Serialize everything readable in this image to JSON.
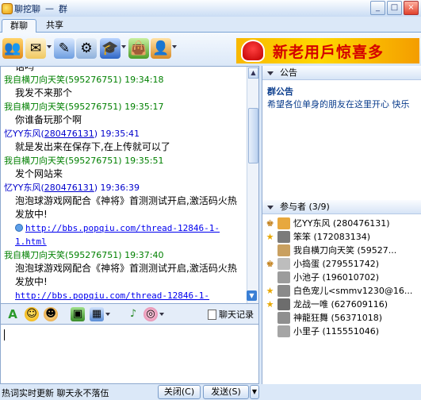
{
  "window": {
    "app_name": "聊挖聊",
    "separator": "—",
    "group_name": "群",
    "buttons": [
      "_",
      "□",
      "×"
    ]
  },
  "tabs": [
    {
      "label": "群聊",
      "active": true
    },
    {
      "label": "共享",
      "active": false
    }
  ],
  "toolbar": {
    "icons": [
      "group-members-icon",
      "mail-icon",
      "tools-icon",
      "settings-icon",
      "cap-icon",
      "bag-icon",
      "person-arrow-icon"
    ]
  },
  "ad_banner": {
    "text": "新老用戶惊喜多"
  },
  "chat": {
    "messages": [
      {
        "sender": "我自横刀向天笑",
        "qq": "595276751",
        "time": "19:34:18",
        "color": "green",
        "lines": [
          "我发不来那个"
        ]
      },
      {
        "sender": "我自横刀向天笑",
        "qq": "595276751",
        "time": "19:35:17",
        "color": "green",
        "lines": [
          "你谁备玩那个啊"
        ]
      },
      {
        "sender": "忆YY东风",
        "qq": "280476131",
        "time": "19:35:41",
        "color": "blue",
        "lines": [
          "就是发出来在保存下,在上传就可以了"
        ]
      },
      {
        "sender": "我自横刀向天笑",
        "qq": "595276751",
        "time": "19:35:51",
        "color": "green",
        "lines": [
          "发个网站来"
        ]
      },
      {
        "sender": "忆YY东风",
        "qq": "280476131",
        "time": "19:36:39",
        "color": "blue",
        "text": "泡泡球游戏网配合《神将》首测测试开启,激活码火热发放中!",
        "link": "http://bbs.popqiu.com/thread-12846-1-1.html"
      },
      {
        "sender": "我自横刀向天笑",
        "qq": "595276751",
        "time": "19:37:40",
        "color": "green",
        "text": "泡泡球游戏网配合《神将》首测测试开启,激活码火热发放中!",
        "link": "http://bbs.popqiu.com/thread-12846-1-"
      }
    ],
    "partial_top_line": "话吗"
  },
  "input_toolbar": {
    "chat_history_label": "聊天记录"
  },
  "bottom": {
    "status_text": "热词实时更新 聊天永不落伍",
    "close_label": "关闭(C)",
    "send_label": "发送(S)",
    "send_arrow": "▼"
  },
  "notice": {
    "header": "公告",
    "title": "群公告",
    "text": "希望各位单身的朋友在这里开心 快乐"
  },
  "members": {
    "header": "参与者 (3/9)",
    "list": [
      {
        "name": "忆YY东风 (280476131)",
        "role": "admin",
        "avatar_color": "#e7a83e"
      },
      {
        "name": "笨笨 (172083134)",
        "role": "star",
        "avatar_color": "#7b7b7b"
      },
      {
        "name": "我自横刀向天笑 (59527...",
        "role": "none",
        "avatar_color": "#c9a060"
      },
      {
        "name": "小捣蛋 (279551742)",
        "role": "admin",
        "avatar_color": "#bdbdbd"
      },
      {
        "name": "小池子 (196010702)",
        "role": "none",
        "avatar_color": "#9c9c9c"
      },
      {
        "name": "白色宠儿<smmv1230@16...",
        "role": "star",
        "avatar_color": "#8a8a8a"
      },
      {
        "name": "龙战一唯 (627609116)",
        "role": "star",
        "avatar_color": "#6d6d6d"
      },
      {
        "name": "神龍狂舞 (56371018)",
        "role": "none",
        "avatar_color": "#8f8f8f"
      },
      {
        "name": "小里子 (115551046)",
        "role": "none",
        "avatar_color": "#a5a5a5"
      }
    ]
  }
}
